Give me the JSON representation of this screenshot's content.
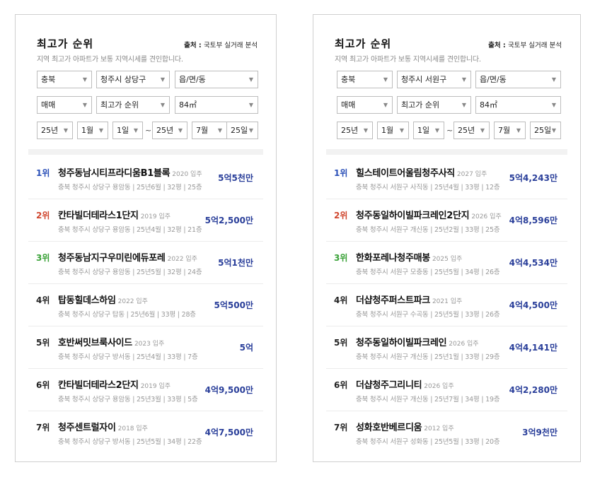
{
  "panels": [
    {
      "title": "최고가 순위",
      "source_label": "출처 : ",
      "source_name": "국토부 실거래 분석",
      "subtitle": "지역 최고가 아파트가 보통 지역시세를 견인합니다.",
      "filters": {
        "province": "충북",
        "city": "청주시 상당구",
        "town": "읍/면/동",
        "deal_type": "매매",
        "sort": "최고가 순위",
        "area": "84㎡",
        "from_year": "25년",
        "from_month": "1월",
        "from_day": "1일",
        "range_sep": "~",
        "to_year": "25년",
        "to_month": "7월",
        "to_day": "25일"
      },
      "items": [
        {
          "rank": "1위",
          "name": "청주동남시티프라디움B1블록",
          "year": "2020 입주",
          "meta": "충북 청주시 상당구 용암동 | 25년6월 | 32평 | 25층",
          "price": "5억5천만"
        },
        {
          "rank": "2위",
          "name": "칸타빌더테라스1단지",
          "year": "2019 입주",
          "meta": "충북 청주시 상당구 용암동 | 25년4월 | 32평 | 21층",
          "price": "5억2,500만"
        },
        {
          "rank": "3위",
          "name": "청주동남지구우미린에듀포레",
          "year": "2022 입주",
          "meta": "충북 청주시 상당구 용암동 | 25년5월 | 32평 | 24층",
          "price": "5억1천만"
        },
        {
          "rank": "4위",
          "name": "탑동힐데스하임",
          "year": "2022 입주",
          "meta": "충북 청주시 상당구 탑동 | 25년6월 | 33평 | 28층",
          "price": "5억500만"
        },
        {
          "rank": "5위",
          "name": "호반써밋브룩사이드",
          "year": "2023 입주",
          "meta": "충북 청주시 상당구 방서동 | 25년4월 | 33평 | 7층",
          "price": "5억"
        },
        {
          "rank": "6위",
          "name": "칸타빌더테라스2단지",
          "year": "2019 입주",
          "meta": "충북 청주시 상당구 용암동 | 25년3월 | 33평 | 5층",
          "price": "4억9,500만"
        },
        {
          "rank": "7위",
          "name": "청주센트럴자이",
          "year": "2018 입주",
          "meta": "충북 청주시 상당구 방서동 | 25년5월 | 34평 | 22층",
          "price": "4억7,500만"
        }
      ]
    },
    {
      "title": "최고가 순위",
      "source_label": "출처 : ",
      "source_name": "국토부 실거래 분석",
      "subtitle": "지역 최고가 아파트가 보통 지역시세를 견인합니다.",
      "filters": {
        "province": "충북",
        "city": "청주시 서원구",
        "town": "읍/면/동",
        "deal_type": "매매",
        "sort": "최고가 순위",
        "area": "84㎡",
        "from_year": "25년",
        "from_month": "1월",
        "from_day": "1일",
        "range_sep": "~",
        "to_year": "25년",
        "to_month": "7월",
        "to_day": "25일"
      },
      "items": [
        {
          "rank": "1위",
          "name": "힐스테이트어울림청주사직",
          "year": "2027 입주",
          "meta": "충북 청주시 서원구 사직동 | 25년4월 | 33평 | 12층",
          "price": "5억4,243만"
        },
        {
          "rank": "2위",
          "name": "청주동일하이빌파크레인2단지",
          "year": "2026 입주",
          "meta": "충북 청주시 서원구 개신동 | 25년2월 | 33평 | 25층",
          "price": "4억8,596만"
        },
        {
          "rank": "3위",
          "name": "한화포레나청주매봉",
          "year": "2025 입주",
          "meta": "충북 청주시 서원구 모충동 | 25년5월 | 34평 | 26층",
          "price": "4억4,534만"
        },
        {
          "rank": "4위",
          "name": "더샵청주퍼스트파크",
          "year": "2021 입주",
          "meta": "충북 청주시 서원구 수곡동 | 25년5월 | 33평 | 26층",
          "price": "4억4,500만"
        },
        {
          "rank": "5위",
          "name": "청주동일하이빌파크레인",
          "year": "2026 입주",
          "meta": "충북 청주시 서원구 개신동 | 25년1월 | 33평 | 29층",
          "price": "4억4,141만"
        },
        {
          "rank": "6위",
          "name": "더샵청주그리니티",
          "year": "2026 입주",
          "meta": "충북 청주시 서원구 개신동 | 25년7월 | 34평 | 19층",
          "price": "4억2,280만"
        },
        {
          "rank": "7위",
          "name": "성화호반베르디움",
          "year": "2012 입주",
          "meta": "충북 청주시 서원구 성화동 | 25년5월 | 33평 | 20층",
          "price": "3억9천만"
        }
      ]
    }
  ]
}
